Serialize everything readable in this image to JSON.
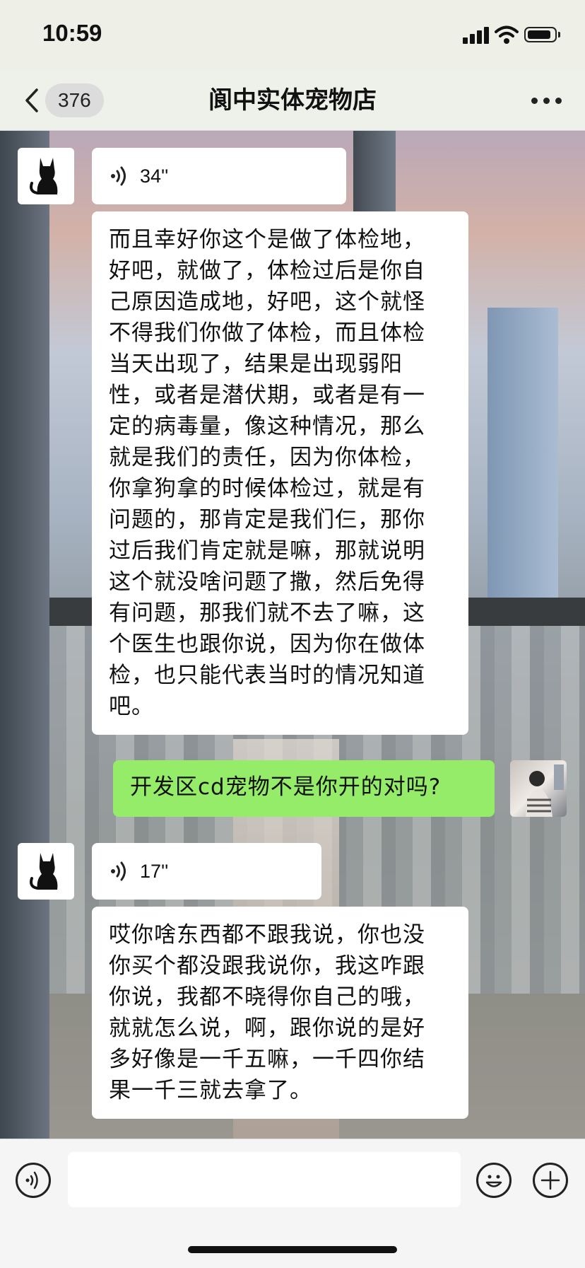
{
  "status_bar": {
    "time": "10:59"
  },
  "header": {
    "unread_count": "376",
    "title": "阆中实体宠物店"
  },
  "messages": [
    {
      "type": "voice",
      "sender": "other",
      "duration": "34''"
    },
    {
      "type": "text",
      "sender": "other",
      "lines": [
        "而且幸好你这个是做了体检地，",
        "好吧，就做了，体检过后是你自",
        "己原因造成地，好吧，这个就怪",
        "不得我们你做了体检，而且体检",
        "当天出现了，结果是出现弱阳",
        "性，或者是潜伏期，或者是有一",
        "定的病毒量，像这种情况，那么",
        "就是我们的责任，因为你体检，",
        "你拿狗拿的时候体检过，就是有",
        "问题的，那肯定是我们仨，那你",
        "过后我们肯定就是嘛，那就说明",
        "这个就没啥问题了撒，然后免得",
        "有问题，那我们就不去了嘛，这",
        "个医生也跟你说，因为你在做体",
        "检，也只能代表当时的情况知道",
        "吧。"
      ]
    },
    {
      "type": "text",
      "sender": "me",
      "text": "开发区cd宠物不是你开的对吗?"
    },
    {
      "type": "voice",
      "sender": "other",
      "duration": "17''"
    },
    {
      "type": "text",
      "sender": "other",
      "lines": [
        "哎你啥东西都不跟我说，你也没",
        "你买个都没跟我说你，我这咋跟",
        "你说，我都不晓得你自己的哦，",
        "就就怎么说，啊，跟你说的是好",
        "多好像是一千五嘛，一千四你结",
        "果一千三就去拿了。"
      ]
    }
  ],
  "input_bar": {
    "placeholder": ""
  },
  "colors": {
    "my_bubble": "#95ec69",
    "other_bubble": "#ffffff"
  }
}
